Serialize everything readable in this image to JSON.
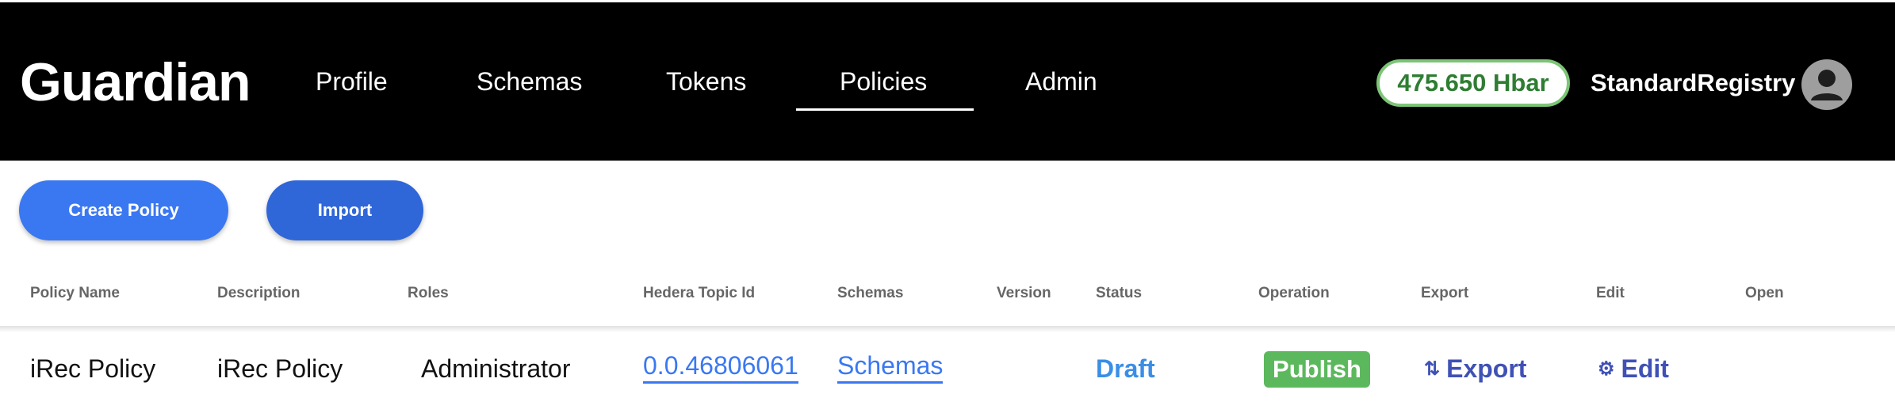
{
  "header": {
    "logo": "Guardian",
    "nav": [
      {
        "label": "Profile"
      },
      {
        "label": "Schemas"
      },
      {
        "label": "Tokens"
      },
      {
        "label": "Policies",
        "active": true
      },
      {
        "label": "Admin"
      }
    ],
    "balance": "475.650 Hbar",
    "username": "StandardRegistry",
    "avatar_icon": "user-avatar-icon"
  },
  "toolbar": {
    "create_label": "Create Policy",
    "import_label": "Import"
  },
  "table": {
    "columns": [
      "Policy Name",
      "Description",
      "Roles",
      "Hedera Topic Id",
      "Schemas",
      "Version",
      "Status",
      "Operation",
      "Export",
      "Edit",
      "Open"
    ],
    "rows": [
      {
        "policy_name": "iRec Policy",
        "description": "iRec Policy",
        "roles": "Administrator",
        "topic_id": "0.0.46806061",
        "schemas": "Schemas",
        "version": "",
        "status": "Draft",
        "operation": "Publish",
        "export": "Export",
        "export_icon": "swap-vert-icon",
        "edit": "Edit",
        "edit_icon": "gear-icon"
      }
    ]
  },
  "colors": {
    "topbar": "#000000",
    "primary": "#3a78f2",
    "balance_border": "#7cc576",
    "balance_text": "#2e7d32",
    "status_draft": "#3a8ee6",
    "publish_bg": "#5cb85c",
    "action_link": "#3f51b5"
  }
}
